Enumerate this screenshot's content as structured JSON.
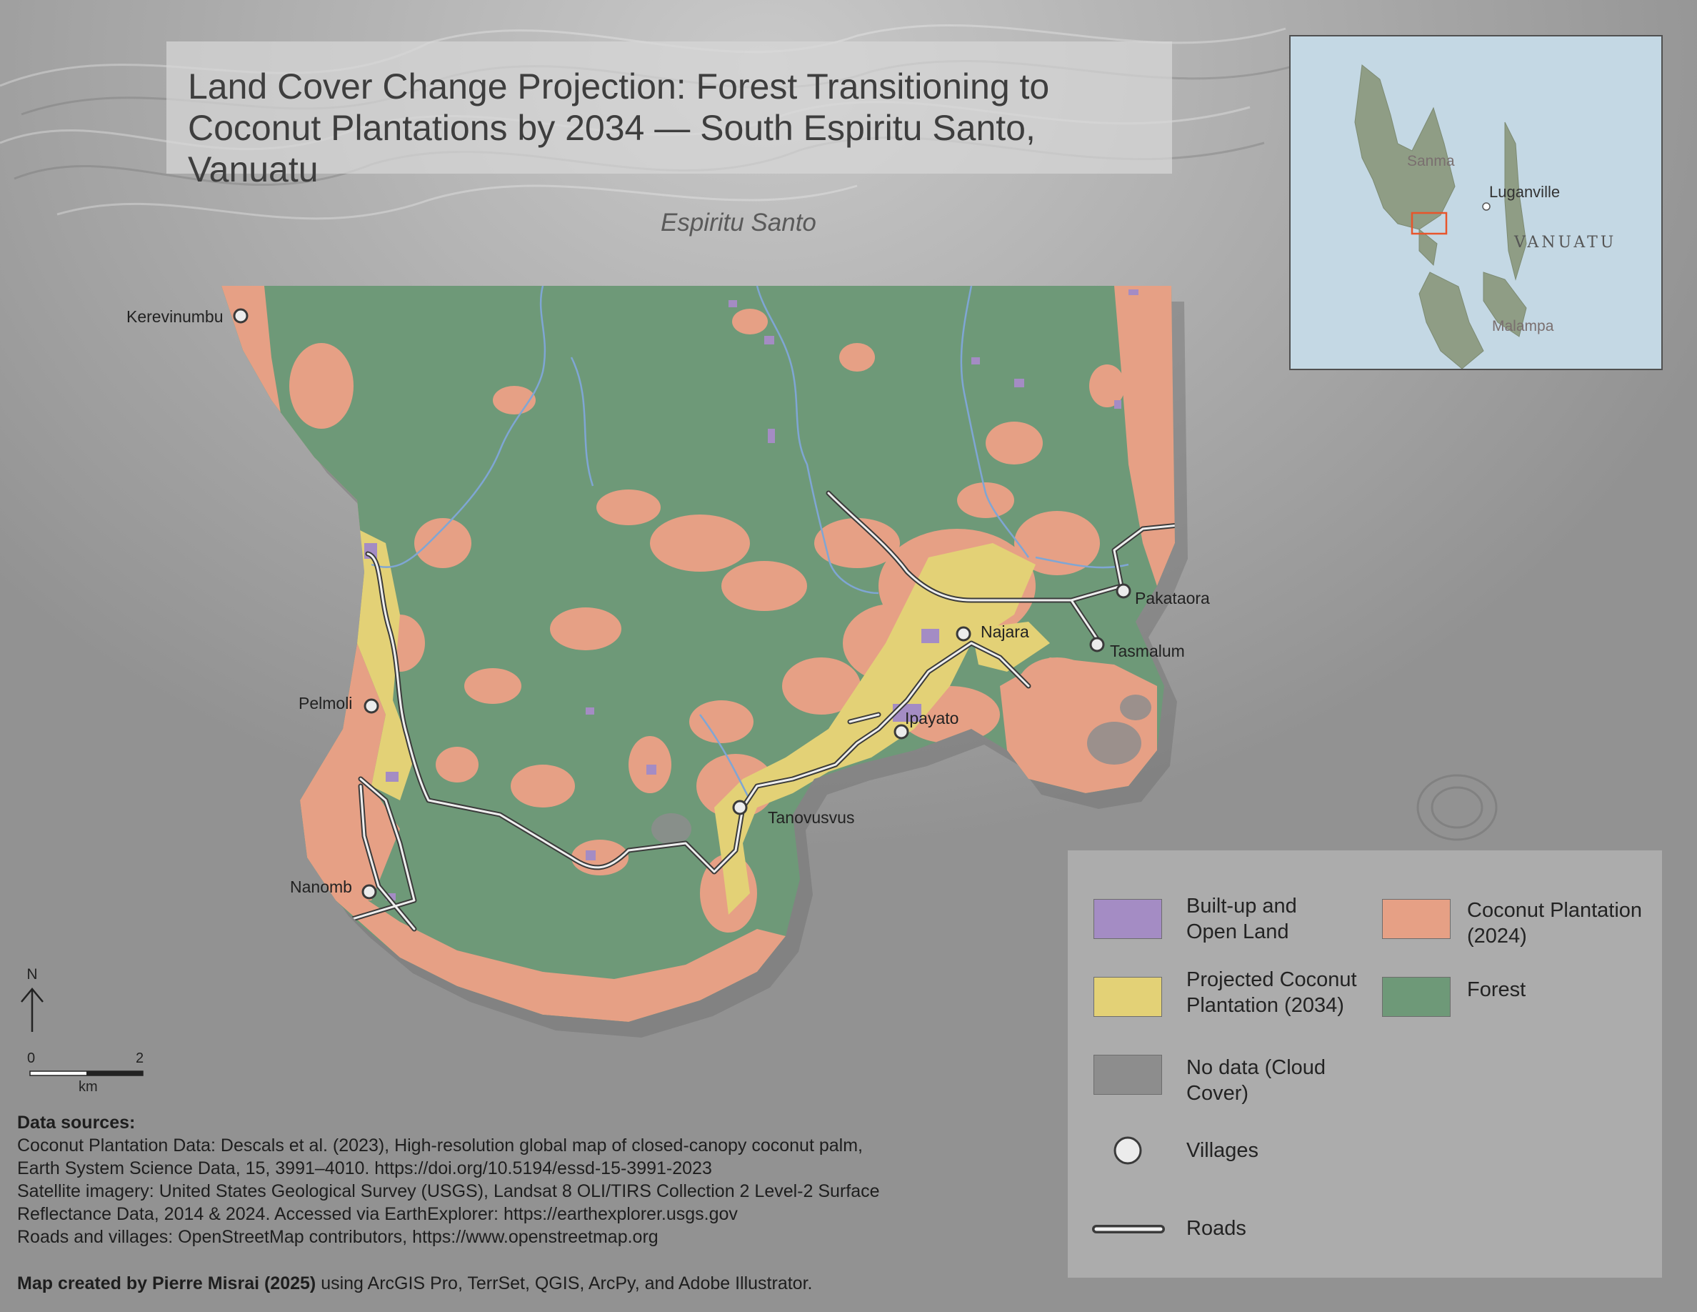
{
  "title": "Land Cover Change Projection: Forest Transitioning to Coconut Plantations by 2034 — South Espiritu Santo, Vanuatu",
  "island_label": "Espiritu Santo",
  "villages": [
    "Kerevinumbu",
    "Pelmoli",
    "Nanomb",
    "Tanovusvus",
    "Ipayato",
    "Najara",
    "Pakataora",
    "Tasmalum"
  ],
  "inset": {
    "labels": {
      "province_north": "Sanma",
      "province_south": "Malampa",
      "city": "Luganville",
      "country": "VANUATU"
    },
    "extent_box_color": "#e8552b"
  },
  "legend": {
    "items": [
      {
        "key": "built",
        "label": "Built-up and Open Land",
        "color": "#a48cc4"
      },
      {
        "key": "coconut_2024",
        "label": "Coconut Plantation (2024)",
        "color": "#e6a085"
      },
      {
        "key": "projected_2034",
        "label": "Projected Coconut Plantation (2034)",
        "color": "#e3d176"
      },
      {
        "key": "forest",
        "label": "Forest",
        "color": "#6e9978"
      },
      {
        "key": "nodata",
        "label": "No data (Cloud Cover)",
        "color": "#8d8d8d"
      },
      {
        "key": "villages",
        "label": "Villages",
        "icon": "village-circle-icon"
      },
      {
        "key": "roads",
        "label": "Roads",
        "icon": "road-line-icon"
      }
    ]
  },
  "north_arrow": {
    "label": "N"
  },
  "scale_bar": {
    "start": "0",
    "end": "2",
    "unit": "km"
  },
  "sources": {
    "heading": "Data sources:",
    "lines": [
      "Coconut Plantation Data: Descals et al. (2023), High-resolution global map of closed-canopy coconut palm,",
      "Earth System Science Data, 15, 3991–4010. https://doi.org/10.5194/essd-15-3991-2023",
      "Satellite imagery: United States Geological Survey (USGS), Landsat 8 OLI/TIRS Collection 2 Level-2 Surface",
      "Reflectance Data, 2014 & 2024. Accessed via EarthExplorer: https://earthexplorer.usgs.gov",
      "Roads and villages: OpenStreetMap contributors, https://www.openstreetmap.org"
    ]
  },
  "credit": {
    "bold": "Map created by Pierre Misrai (2025)",
    "rest": " using ArcGIS Pro, TerrSet, QGIS, ArcPy, and Adobe Illustrator."
  }
}
